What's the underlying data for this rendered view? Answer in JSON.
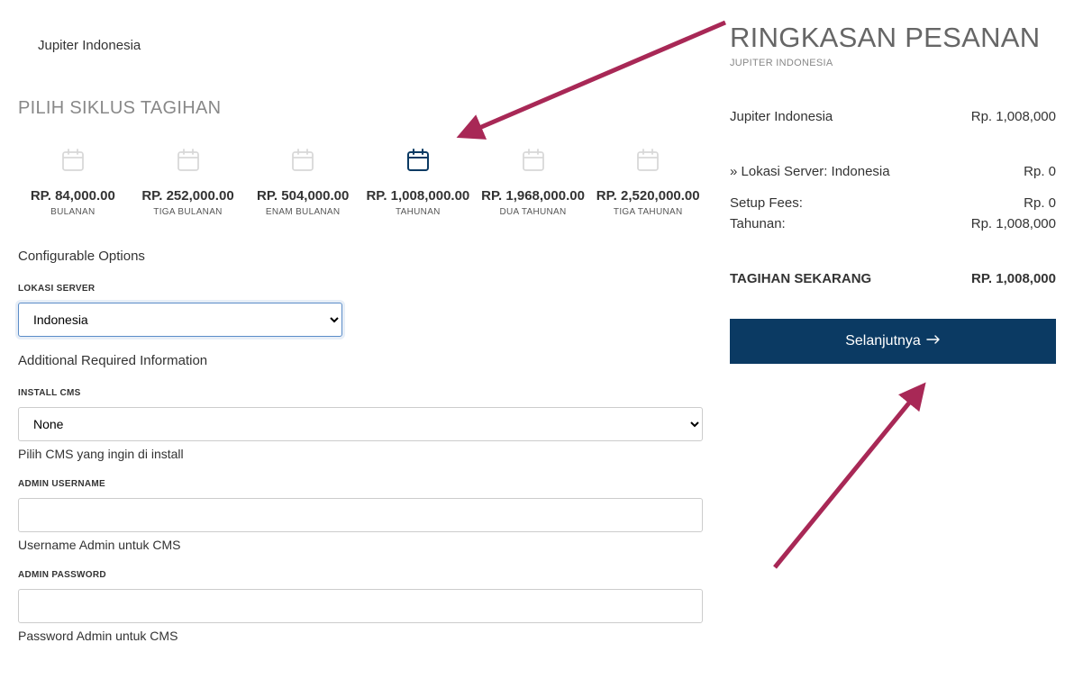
{
  "product_name": "Jupiter Indonesia",
  "headings": {
    "billing_cycle": "PILIH SIKLUS TAGIHAN",
    "configurable_options": "Configurable Options",
    "additional_info": "Additional Required Information"
  },
  "billing_cycles": [
    {
      "price": "RP. 84,000.00",
      "label": "BULANAN",
      "selected": false
    },
    {
      "price": "RP. 252,000.00",
      "label": "TIGA BULANAN",
      "selected": false
    },
    {
      "price": "RP. 504,000.00",
      "label": "ENAM BULANAN",
      "selected": false
    },
    {
      "price": "RP. 1,008,000.00",
      "label": "TAHUNAN",
      "selected": true
    },
    {
      "price": "RP. 1,968,000.00",
      "label": "DUA TAHUNAN",
      "selected": false
    },
    {
      "price": "RP. 2,520,000.00",
      "label": "TIGA TAHUNAN",
      "selected": false
    }
  ],
  "fields": {
    "server_location": {
      "label": "LOKASI SERVER",
      "value": "Indonesia"
    },
    "install_cms": {
      "label": "INSTALL CMS",
      "value": "None",
      "hint": "Pilih CMS yang ingin di install"
    },
    "admin_username": {
      "label": "ADMIN USERNAME",
      "value": "",
      "hint": "Username Admin untuk CMS"
    },
    "admin_password": {
      "label": "ADMIN PASSWORD",
      "value": "",
      "hint": "Password Admin untuk CMS"
    }
  },
  "summary": {
    "title": "RINGKASAN PESANAN",
    "subtitle": "JUPITER INDONESIA",
    "product": {
      "name": "Jupiter Indonesia",
      "price": "Rp. 1,008,000"
    },
    "server_location": {
      "label": " » Lokasi Server: Indonesia",
      "price": "Rp. 0"
    },
    "setup_fees": {
      "label": "Setup Fees:",
      "price": "Rp. 0"
    },
    "period": {
      "label": "Tahunan:",
      "price": "Rp. 1,008,000"
    },
    "total": {
      "label": "TAGIHAN SEKARANG",
      "price": "RP. 1,008,000"
    },
    "next_button": "Selanjutnya"
  },
  "colors": {
    "annotation_arrow": "#a82856",
    "button_bg": "#0b3a63",
    "selected_icon": "#0b3a63",
    "unselected_icon": "#d8d8d8"
  }
}
